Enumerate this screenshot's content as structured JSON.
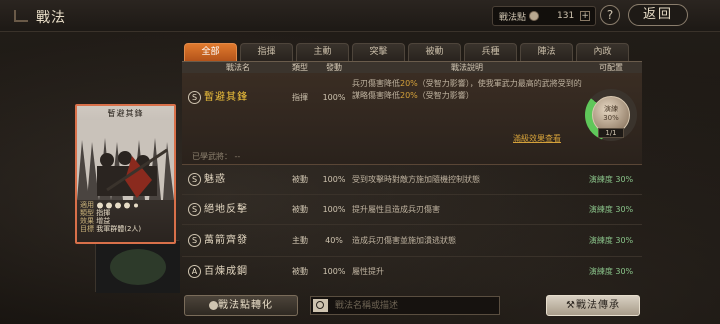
{
  "header": {
    "title": "戰法",
    "points_label": "戰法點",
    "points_value": "131",
    "plus": "+",
    "help": "?",
    "back": "返回"
  },
  "tabs": [
    "全部",
    "指揮",
    "主動",
    "突擊",
    "被動",
    "兵種",
    "陣法",
    "內政"
  ],
  "active_tab": "全部",
  "columns": {
    "name": "戰法名",
    "type": "類型",
    "trigger": "發動",
    "desc": "戰法說明",
    "prof": "可配置"
  },
  "selected": {
    "grade": "S",
    "name": "暫避其鋒",
    "type": "指揮",
    "trigger": "100%",
    "desc_parts": [
      "兵刃傷害降低",
      "20%",
      "（受智力影響），使我軍武力最高的武將受到的謀略傷害降低",
      "20%",
      "（受智力影響）"
    ],
    "details_link": "滿級效果查看",
    "proficiency_label": "演練",
    "proficiency_value": "30%",
    "count": "1/1",
    "learned": "已學武將： --"
  },
  "rows": [
    {
      "grade": "S",
      "name": "魅惑",
      "type": "被動",
      "trigger": "100%",
      "desc": "受到攻擊時對敵方施加隨機控制狀態",
      "prof": "演練度 30%"
    },
    {
      "grade": "S",
      "name": "絕地反擊",
      "type": "被動",
      "trigger": "100%",
      "desc": "提升屬性且造成兵刃傷害",
      "prof": "演練度 30%"
    },
    {
      "grade": "S",
      "name": "萬箭齊發",
      "type": "主動",
      "trigger": "40%",
      "desc": "造成兵刃傷害並施加潰逃狀態",
      "prof": "演練度 30%"
    },
    {
      "grade": "A",
      "name": "百煉成鋼",
      "type": "被動",
      "trigger": "100%",
      "desc": "屬性提升",
      "prof": "演練度 30%"
    }
  ],
  "card": {
    "title": "暫避其鋒",
    "l1": "適用",
    "l2": "類型",
    "v2": "指揮",
    "l3": "效果",
    "v3": "增益",
    "l4": "目標",
    "v4": "我軍群體(2人)"
  },
  "bottom": {
    "convert": "戰法點轉化",
    "search_placeholder": "戰法名稱或描述",
    "inherit": "戰法傳承"
  },
  "colors": {
    "accent": "#e07a2e",
    "gold": "#d4a13a",
    "green": "#8ac48a"
  }
}
